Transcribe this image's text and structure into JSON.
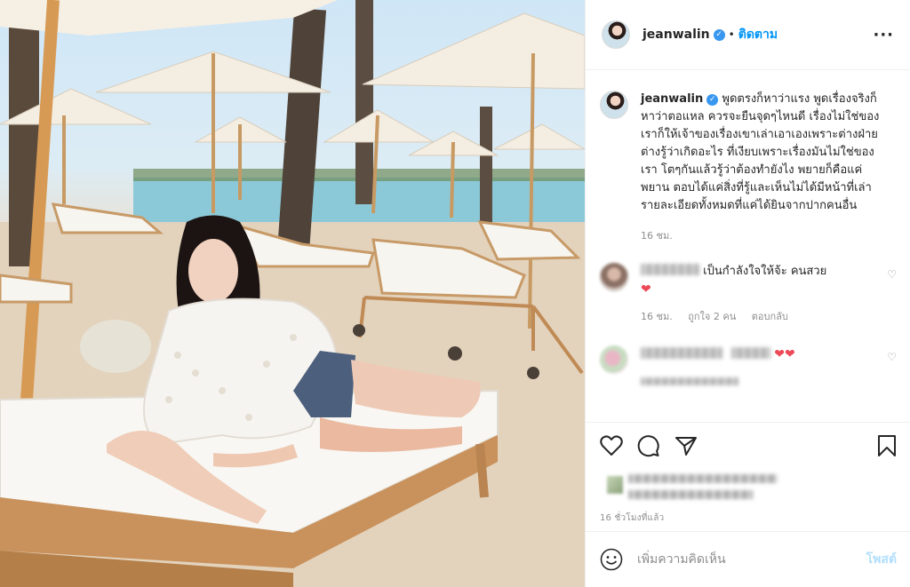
{
  "header": {
    "username": "jeanwalin",
    "separator": "•",
    "follow_label": "ติดตาม",
    "more_icon": "more-options-icon"
  },
  "caption": {
    "username": "jeanwalin",
    "text": "พูดตรงก็หาว่าแรง พูดเรื่องจริงก็หาว่าตอแหล ควรจะยืนจุดๆไหนดี เรื่องไม่ใช่ของเราก็ให้เจ้าของเรื่องเขาเล่าเอาเองเพราะต่างฝ่ายต่างรู้ว่าเกิดอะไร ที่เงียบเพราะเรื่องมันไม่ใช่ของเรา โตๆกันแล้วรู้ว่าต้องทำยังไง พยายก็คือแค่พยาน ตอบได้แค่สิ่งที่รู้และเห็นไม่ได้มีหน้าที่เล่ารายละเอียดทั้งหมดที่แค่ได้ยินจากปากคนอื่น",
    "time": "16 ชม."
  },
  "comments": [
    {
      "text": "เป็นกำลังใจให้จ้ะ คนสวย",
      "emoji": "❤",
      "time": "16 ชม.",
      "likes": "ถูกใจ 2 คน",
      "reply": "ตอบกลับ"
    },
    {
      "emoji": "❤❤"
    }
  ],
  "actions": {
    "timestamp": "16 ชั่วโมงที่แล้ว"
  },
  "add_comment": {
    "placeholder": "เพิ่มความคิดเห็น",
    "post_label": "โพสต์"
  },
  "colors": {
    "link_blue": "#0095f6",
    "verified_blue": "#3897f0",
    "heart_red": "#ed4956",
    "muted_text": "#8e8e8e",
    "post_disabled": "#b2dffc"
  }
}
